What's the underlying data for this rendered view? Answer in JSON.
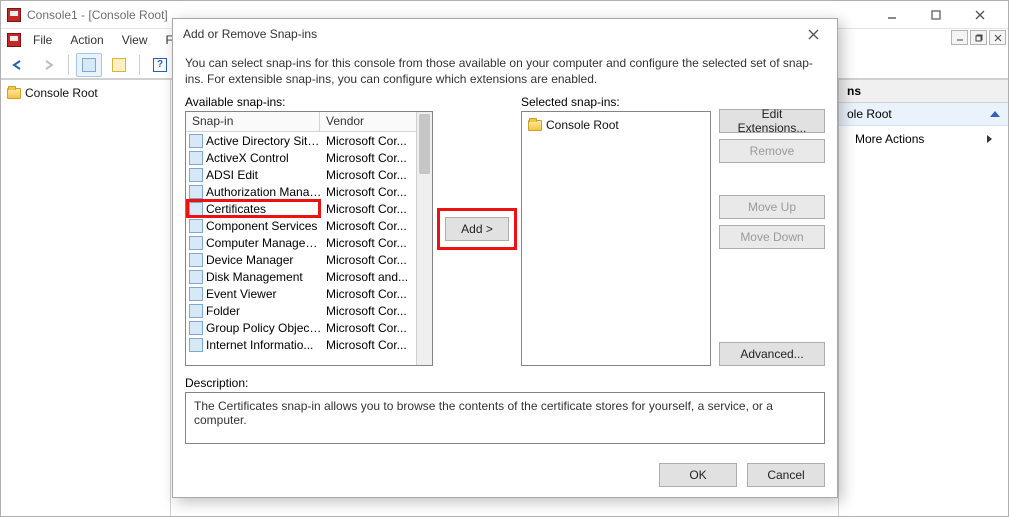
{
  "window": {
    "title": "Console1 - [Console Root]"
  },
  "menus": [
    "File",
    "Action",
    "View",
    "Fav"
  ],
  "tree_root": "Console Root",
  "actions": {
    "header": "ns",
    "subheader": "ole Root",
    "more": "More Actions"
  },
  "dialog": {
    "title": "Add or Remove Snap-ins",
    "intro": "You can select snap-ins for this console from those available on your computer and configure the selected set of snap-ins. For extensible snap-ins, you can configure which extensions are enabled.",
    "available_label": "Available snap-ins:",
    "selected_label": "Selected snap-ins:",
    "columns": {
      "snapin": "Snap-in",
      "vendor": "Vendor"
    },
    "add_btn": "Add >",
    "edit_btn": "Edit Extensions...",
    "remove_btn": "Remove",
    "moveup_btn": "Move Up",
    "movedown_btn": "Move Down",
    "advanced_btn": "Advanced...",
    "desc_label": "Description:",
    "desc_text": "The Certificates snap-in allows you to browse the contents of the certificate stores for yourself, a service, or a computer.",
    "ok": "OK",
    "cancel": "Cancel",
    "selected_root": "Console Root",
    "snapins": [
      {
        "name": "Active Directory Site...",
        "vendor": "Microsoft Cor..."
      },
      {
        "name": "ActiveX Control",
        "vendor": "Microsoft Cor..."
      },
      {
        "name": "ADSI Edit",
        "vendor": "Microsoft Cor..."
      },
      {
        "name": "Authorization Manager",
        "vendor": "Microsoft Cor..."
      },
      {
        "name": "Certificates",
        "vendor": "Microsoft Cor..."
      },
      {
        "name": "Component Services",
        "vendor": "Microsoft Cor..."
      },
      {
        "name": "Computer Managem...",
        "vendor": "Microsoft Cor..."
      },
      {
        "name": "Device Manager",
        "vendor": "Microsoft Cor..."
      },
      {
        "name": "Disk Management",
        "vendor": "Microsoft and..."
      },
      {
        "name": "Event Viewer",
        "vendor": "Microsoft Cor..."
      },
      {
        "name": "Folder",
        "vendor": "Microsoft Cor..."
      },
      {
        "name": "Group Policy Object ...",
        "vendor": "Microsoft Cor..."
      },
      {
        "name": "Internet Informatio...",
        "vendor": "Microsoft Cor..."
      }
    ]
  }
}
